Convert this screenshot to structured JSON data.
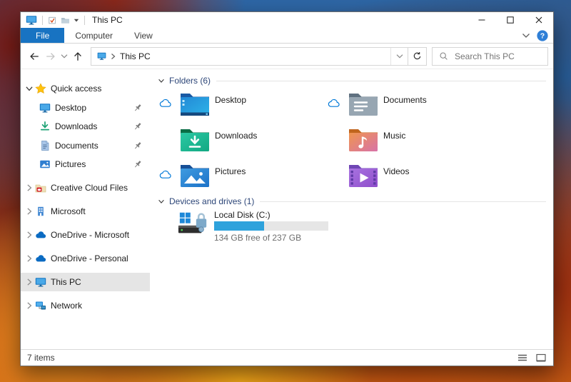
{
  "titlebar": {
    "title": "This PC",
    "qat_icons": [
      "this-pc-icon",
      "properties-icon",
      "new-folder-icon",
      "qat-caret-down-icon"
    ],
    "controls": [
      "minimize",
      "maximize",
      "close"
    ]
  },
  "ribbon": {
    "tabs": [
      "File",
      "Computer",
      "View"
    ],
    "active_tab": "File",
    "right_icons": [
      "collapse-ribbon-chevron-icon",
      "help-icon"
    ]
  },
  "navbar": {
    "breadcrumb_root": "This PC",
    "search_placeholder": "Search This PC",
    "nav_icons": [
      "back-icon",
      "forward-icon",
      "recent-locations-chevron-icon",
      "up-icon",
      "refresh-icon",
      "search-icon"
    ]
  },
  "sidebar": {
    "quick_access": {
      "label": "Quick access",
      "icon": "star",
      "items": [
        {
          "label": "Desktop",
          "icon": "desktop-side",
          "pinned": true
        },
        {
          "label": "Downloads",
          "icon": "downloads-side",
          "pinned": true
        },
        {
          "label": "Documents",
          "icon": "documents-side",
          "pinned": true
        },
        {
          "label": "Pictures",
          "icon": "pictures-side",
          "pinned": true
        }
      ]
    },
    "roots": [
      {
        "label": "Creative Cloud Files",
        "icon": "cc-folder",
        "selected": false
      },
      {
        "label": "Microsoft",
        "icon": "ms-building",
        "selected": false
      },
      {
        "label": "OneDrive - Microsoft",
        "icon": "onedrive-cloud",
        "selected": false
      },
      {
        "label": "OneDrive - Personal",
        "icon": "onedrive-cloud",
        "selected": false
      },
      {
        "label": "This PC",
        "icon": "monitor",
        "selected": true
      },
      {
        "label": "Network",
        "icon": "network",
        "selected": false
      }
    ]
  },
  "content": {
    "folders_section": {
      "title": "Folders (6)",
      "tiles": [
        {
          "label": "Desktop",
          "icon": "folder-desktop",
          "cloud": true
        },
        {
          "label": "Documents",
          "icon": "folder-documents",
          "cloud": true
        },
        {
          "label": "Downloads",
          "icon": "folder-downloads",
          "cloud": false
        },
        {
          "label": "Music",
          "icon": "folder-music",
          "cloud": false
        },
        {
          "label": "Pictures",
          "icon": "folder-pictures",
          "cloud": true
        },
        {
          "label": "Videos",
          "icon": "folder-videos",
          "cloud": false
        }
      ]
    },
    "drives_section": {
      "title": "Devices and drives (1)",
      "drives": [
        {
          "label": "Local Disk (C:)",
          "icon": "drive-c",
          "free_text": "134 GB free of 237 GB",
          "used_percent": 43.5
        }
      ]
    }
  },
  "statusbar": {
    "items_count": "7 items",
    "view_icons": [
      "details-view-icon",
      "thumbnail-view-icon"
    ]
  },
  "colors": {
    "file_tab_accent": "#1873c2",
    "selection_gray": "#e5e5e5",
    "group_header_blue": "#2d4678",
    "progress_fill_blue": "#2ea2dc",
    "onedrive_blue": "#0078d7",
    "quick_access_star": "#ffc20e"
  }
}
